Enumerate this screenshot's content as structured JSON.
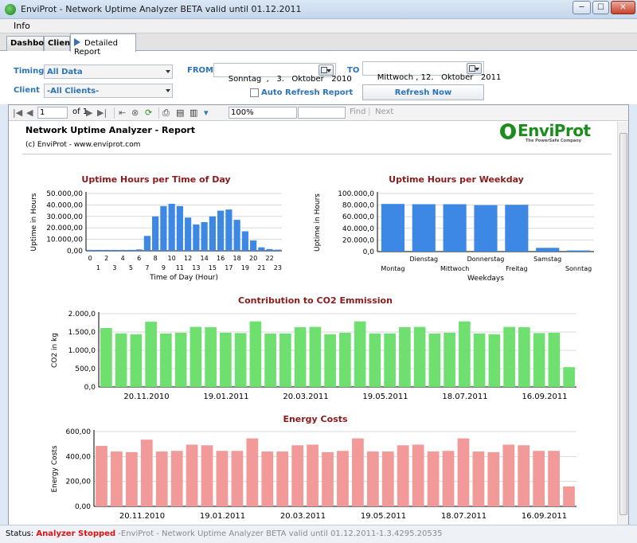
{
  "window": {
    "title": "EnviProt - Network Uptime Analyzer BETA valid until 01.12.2011"
  },
  "menu": {
    "info": "Info"
  },
  "tabs": [
    {
      "label": "Dashboard"
    },
    {
      "label": "Clients"
    },
    {
      "label": "Detailed Report"
    }
  ],
  "filters": {
    "timing_label": "Timing",
    "timing_value": "All Data",
    "client_label": "Client",
    "client_value": "-All Clients-",
    "from_label": "FROM",
    "from_date": "Sonntag  ,   3.   Oktober   2010",
    "to_label": "TO",
    "to_date": "Mittwoch , 12.   Oktober   2011",
    "auto_refresh_label": "Auto Refresh Report",
    "refresh_button": "Refresh Now"
  },
  "viewer": {
    "page": "1",
    "of_label": "of 1",
    "zoom": "100%",
    "find_label": "Find",
    "next_label": "Next"
  },
  "report": {
    "title": "Network Uptime Analyzer - Report",
    "copyright": "(c) EnviProt - www.enviprot.com",
    "logo_text": "EnviProt",
    "logo_sub": "The PowerSafe Company"
  },
  "colors": {
    "blue_bar": "#3d87e5",
    "green_bar": "#6fdf6f",
    "red_bar": "#f29a9a",
    "chart_title": "#8b1a1a",
    "accent": "#2c74b8"
  },
  "chart_data": [
    {
      "id": "time_of_day",
      "type": "bar",
      "title": "Uptime Hours per Time of Day",
      "xlabel": "Time of Day (Hour)",
      "ylabel": "Uptime in Hours",
      "categories": [
        "0",
        "1",
        "2",
        "3",
        "4",
        "5",
        "6",
        "7",
        "8",
        "9",
        "10",
        "11",
        "12",
        "13",
        "14",
        "15",
        "16",
        "17",
        "18",
        "19",
        "20",
        "21",
        "22",
        "23"
      ],
      "values": [
        800,
        800,
        800,
        800,
        800,
        800,
        1200,
        13000,
        30000,
        39000,
        41000,
        39000,
        29000,
        23000,
        25000,
        30000,
        35000,
        36000,
        27000,
        17000,
        9000,
        3000,
        1500,
        1000
      ],
      "ylim": [
        0,
        50000
      ],
      "yticks": [
        "0,00",
        "10.000,00",
        "20.000,00",
        "30.000,00",
        "40.000,00",
        "50.000,00"
      ],
      "xticks_top": [
        "0",
        "2",
        "4",
        "6",
        "8",
        "10",
        "12",
        "14",
        "16",
        "18",
        "20",
        "22"
      ],
      "xticks_bottom": [
        "1",
        "3",
        "5",
        "7",
        "9",
        "11",
        "13",
        "15",
        "17",
        "19",
        "21",
        "23"
      ],
      "grid": true
    },
    {
      "id": "weekday",
      "type": "bar",
      "title": "Uptime Hours per Weekday",
      "xlabel": "Weekdays",
      "ylabel": "Uptime in Hours",
      "categories": [
        "Montag",
        "Dienstag",
        "Mittwoch",
        "Donnerstag",
        "Freitag",
        "Samstag",
        "Sonntag"
      ],
      "values": [
        82000,
        81500,
        81500,
        80000,
        80500,
        6500,
        2000
      ],
      "ylim": [
        0,
        100000
      ],
      "yticks": [
        "0,0",
        "20.000,0",
        "40.000,0",
        "60.000,0",
        "80.000,0",
        "100.000,0"
      ],
      "xticks_top": [
        "Dienstag",
        "Donnerstag",
        "Samstag"
      ],
      "xticks_bottom": [
        "Montag",
        "Mittwoch",
        "Freitag",
        "Sonntag"
      ],
      "grid": true
    },
    {
      "id": "co2",
      "type": "bar",
      "title": "Contribution to CO2 Emmission",
      "ylabel": "CO2 in kg",
      "values": [
        1610,
        1460,
        1440,
        1780,
        1460,
        1480,
        1640,
        1630,
        1480,
        1470,
        1790,
        1460,
        1460,
        1630,
        1640,
        1440,
        1480,
        1790,
        1460,
        1460,
        1630,
        1640,
        1460,
        1480,
        1790,
        1460,
        1440,
        1640,
        1630,
        1470,
        1480,
        540
      ],
      "ylim": [
        0,
        2000
      ],
      "yticks": [
        "0,0",
        "500,0",
        "1.000,0",
        "1.500,0",
        "2.000,0"
      ],
      "xticks": [
        "20.11.2010",
        "19.01.2011",
        "20.03.2011",
        "19.05.2011",
        "18.07.2011",
        "16.09.2011"
      ],
      "grid": true
    },
    {
      "id": "energy",
      "type": "bar",
      "title": "Energy Costs",
      "ylabel": "Energy Costs",
      "values": [
        485,
        440,
        435,
        535,
        440,
        445,
        495,
        490,
        445,
        445,
        545,
        440,
        440,
        490,
        495,
        435,
        445,
        545,
        440,
        440,
        490,
        495,
        440,
        445,
        545,
        440,
        435,
        495,
        490,
        445,
        445,
        160
      ],
      "ylim": [
        0,
        600
      ],
      "yticks": [
        "0,00",
        "200,00",
        "400,00",
        "600,00"
      ],
      "xticks": [
        "20.11.2010",
        "19.01.2011",
        "20.03.2011",
        "19.05.2011",
        "18.07.2011",
        "16.09.2011"
      ],
      "grid": true
    }
  ],
  "status": {
    "label": "Status:",
    "state": "Analyzer Stopped",
    "text": "-EnviProt - Network Uptime Analyzer BETA valid until 01.12.2011-1.3.4295.20535"
  }
}
